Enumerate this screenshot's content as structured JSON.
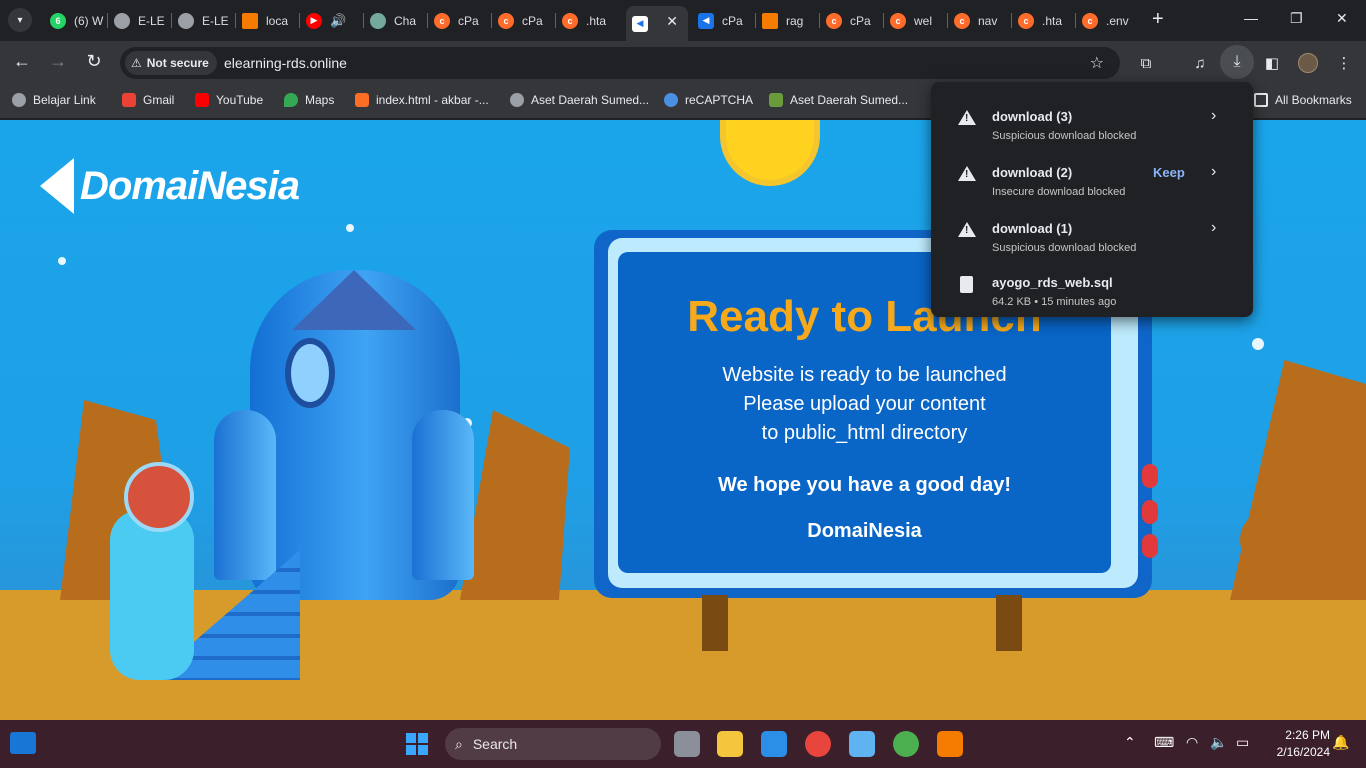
{
  "tabs": [
    {
      "label": "(6) W",
      "favicon": "whatsapp-icon",
      "color": "#25d366",
      "badge": "6"
    },
    {
      "label": "E-LE",
      "favicon": "globe-icon",
      "color": "#9aa0a6"
    },
    {
      "label": "E-LE",
      "favicon": "globe-icon",
      "color": "#9aa0a6"
    },
    {
      "label": "loca",
      "favicon": "xampp-icon",
      "color": "#f57c00"
    },
    {
      "label": "",
      "favicon": "youtube-music-icon",
      "color": "#ff0000"
    },
    {
      "label": "Cha",
      "favicon": "chatgpt-icon",
      "color": "#74aa9c"
    },
    {
      "label": "cPa",
      "favicon": "cpanel-icon",
      "color": "#ff6c2c"
    },
    {
      "label": "cPa",
      "favicon": "cpanel-icon",
      "color": "#ff6c2c"
    },
    {
      "label": ".hta",
      "favicon": "cpanel-icon",
      "color": "#ff6c2c"
    },
    {
      "label": "",
      "favicon": "domainesia-icon",
      "color": "#1a73e8",
      "active": true
    },
    {
      "label": "cPa",
      "favicon": "domainesia-icon",
      "color": "#1a73e8"
    },
    {
      "label": "rag",
      "favicon": "xampp-icon",
      "color": "#f57c00"
    },
    {
      "label": "cPa",
      "favicon": "cpanel-icon",
      "color": "#ff6c2c"
    },
    {
      "label": "wel",
      "favicon": "cpanel-icon",
      "color": "#ff6c2c"
    },
    {
      "label": "nav",
      "favicon": "cpanel-icon",
      "color": "#ff6c2c"
    },
    {
      "label": ".hta",
      "favicon": "cpanel-icon",
      "color": "#ff6c2c"
    },
    {
      "label": ".env",
      "favicon": "cpanel-icon",
      "color": "#ff6c2c"
    }
  ],
  "toolbar": {
    "security_label": "Not secure",
    "url": "elearning-rds.online"
  },
  "bookmarks": [
    {
      "label": "Belajar Link",
      "icon": "globe-icon",
      "color": "#9aa0a6"
    },
    {
      "label": "Gmail",
      "icon": "gmail-icon",
      "color": "#ea4335"
    },
    {
      "label": "YouTube",
      "icon": "youtube-icon",
      "color": "#ff0000"
    },
    {
      "label": "Maps",
      "icon": "maps-icon",
      "color": "#34a853"
    },
    {
      "label": "index.html - akbar -...",
      "icon": "gitlab-icon",
      "color": "#fc6d26"
    },
    {
      "label": "Aset Daerah Sumed...",
      "icon": "globe-icon",
      "color": "#9aa0a6"
    },
    {
      "label": "reCAPTCHA",
      "icon": "recaptcha-icon",
      "color": "#4a90e2"
    },
    {
      "label": "Aset Daerah Sumed...",
      "icon": "emblem-icon",
      "color": "#6a9b3b"
    }
  ],
  "all_bookmarks_label": "All Bookmarks",
  "downloads": [
    {
      "filename": "download (3)",
      "status": "Suspicious download blocked",
      "action": "",
      "icon": "warning-icon"
    },
    {
      "filename": "download (2)",
      "status": "Insecure download blocked",
      "action": "Keep",
      "icon": "warning-icon"
    },
    {
      "filename": "download (1)",
      "status": "Suspicious download blocked",
      "action": "",
      "icon": "warning-icon"
    },
    {
      "filename": "ayogo_rds_web.sql",
      "status": "64.2 KB • 15 minutes ago",
      "action": "",
      "icon": "file-icon"
    }
  ],
  "page": {
    "logo_text": "DomaiNesia",
    "title": "Ready to Launch",
    "lines": [
      "Website is ready to be launched",
      "Please upload your content",
      "to public_html directory"
    ],
    "hope": "We hope you have a good day!",
    "brand": "DomaiNesia"
  },
  "taskbar": {
    "search_label": "Search",
    "time": "2:26 PM",
    "date": "2/16/2024"
  },
  "colors": {
    "sky": "#1aa5ea",
    "ground": "#d79b2b",
    "title_accent": "#f6a91b",
    "board": "#0965c6",
    "link_blue": "#8ab4f8"
  }
}
